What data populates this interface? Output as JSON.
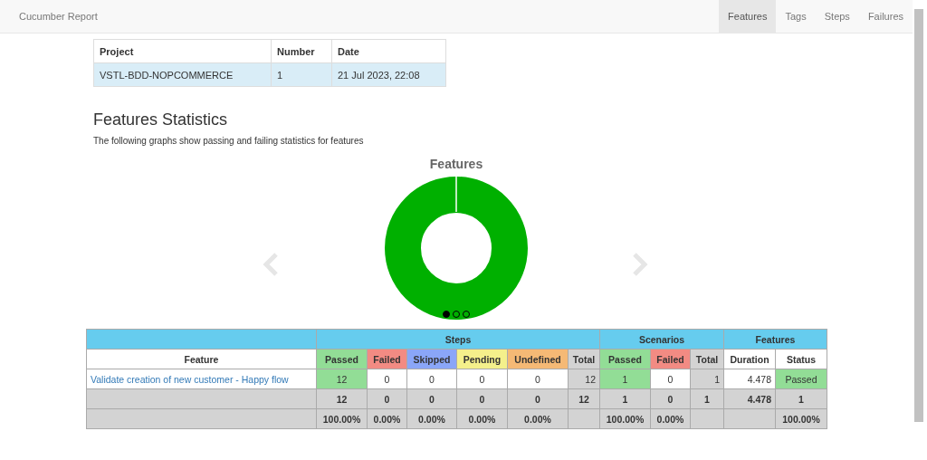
{
  "navbar": {
    "brand": "Cucumber Report",
    "tabs": [
      {
        "label": "Features",
        "selected": true
      },
      {
        "label": "Tags",
        "selected": false
      },
      {
        "label": "Steps",
        "selected": false
      },
      {
        "label": "Failures",
        "selected": false
      }
    ]
  },
  "project_table": {
    "columns": [
      "Project",
      "Number",
      "Date"
    ],
    "row": [
      "VSTL-BDD-NOPCOMMERCE",
      "1",
      "21 Jul 2023, 22:08"
    ]
  },
  "heading": "Features Statistics",
  "subheading": "The following graphs show passing and failing statistics for features",
  "carousel": {
    "title": "Features",
    "indicators": [
      {
        "selected": true
      },
      {
        "selected": false
      },
      {
        "selected": false
      }
    ]
  },
  "stats_table": {
    "groups": [
      "Steps",
      "Scenarios",
      "Features"
    ],
    "columns": [
      {
        "label": "Feature",
        "kind": "name"
      },
      {
        "label": "Passed",
        "kind": "passed"
      },
      {
        "label": "Failed",
        "kind": "failed"
      },
      {
        "label": "Skipped",
        "kind": "skipped"
      },
      {
        "label": "Pending",
        "kind": "pending"
      },
      {
        "label": "Undefined",
        "kind": "undefined"
      },
      {
        "label": "Total",
        "kind": "total"
      },
      {
        "label": "Passed",
        "kind": "passed"
      },
      {
        "label": "Failed",
        "kind": "failed"
      },
      {
        "label": "Total",
        "kind": "total"
      },
      {
        "label": "Duration",
        "kind": "plain"
      },
      {
        "label": "Status",
        "kind": "status"
      }
    ],
    "rows": [
      {
        "kind": "feature",
        "cells": [
          "Validate creation of new customer - Happy flow",
          "12",
          "0",
          "0",
          "0",
          "0",
          "12",
          "1",
          "0",
          "1",
          "4.478",
          "Passed"
        ]
      },
      {
        "kind": "totals",
        "cells": [
          "",
          "12",
          "0",
          "0",
          "0",
          "0",
          "12",
          "1",
          "0",
          "1",
          "4.478",
          "1"
        ]
      },
      {
        "kind": "percent",
        "cells": [
          "",
          "100.00%",
          "0.00%",
          "0.00%",
          "0.00%",
          "0.00%",
          "",
          "100.00%",
          "0.00%",
          "",
          "",
          "100.00%"
        ]
      }
    ]
  }
}
